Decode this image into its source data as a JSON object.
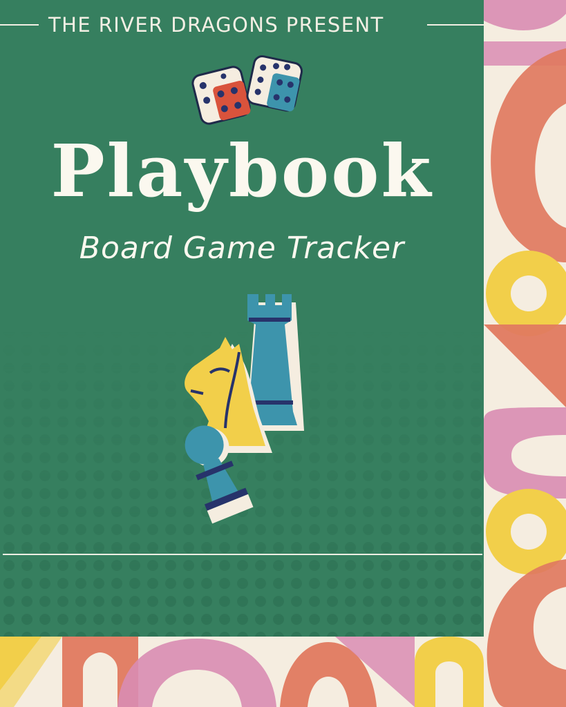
{
  "cover": {
    "presenter": "THE RIVER DRAGONS PRESENT",
    "title": "Playbook",
    "subtitle": "Board Game Tracker"
  },
  "colors": {
    "panel_green": "#367f5f",
    "cream": "#f5ede0",
    "coral": "#e07a5f",
    "pink": "#d98cb3",
    "yellow": "#f2cf4a",
    "teal": "#3d94ac",
    "navy": "#27336b"
  },
  "icons": [
    "dice-icon",
    "chess-knight-icon",
    "chess-rook-icon",
    "chess-pawn-icon"
  ]
}
